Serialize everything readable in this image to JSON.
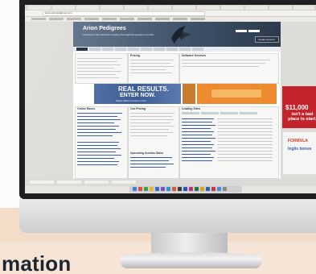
{
  "caption": "mation",
  "browser": {
    "url_text": "www.arionpedigrees.com"
  },
  "site": {
    "title": "Arion Pedigrees",
    "tagline": "Australia & New Zealand's leading thoroughbred pedigree provider",
    "login_button": "Create Account"
  },
  "sections": {
    "pricing": "Pricing",
    "software": "Software Services",
    "online_races": "Online Races",
    "our_pricing": "Our Pricing",
    "leading_sires": "Leading Sires",
    "upcoming": "Upcoming Auction Sales"
  },
  "ads": {
    "real_results_1": "REAL RESULTS.",
    "real_results_2": "ENTER NOW.",
    "real_results_3": "Magic Millions  Ready to Run",
    "right_amount": "$11,000",
    "right_text": "isn't a bad place to start.",
    "inglis_1": "FORMULA",
    "inglis_2": "Inglis bonus"
  },
  "colors": {
    "header": "#3d4f66",
    "nav_active": "#1d2c3d",
    "ad_blue": "#3a5a93",
    "ad_orange": "#ee8a2e",
    "ad_red": "#c3232b",
    "backdrop_peach": "#f3dcc8"
  }
}
